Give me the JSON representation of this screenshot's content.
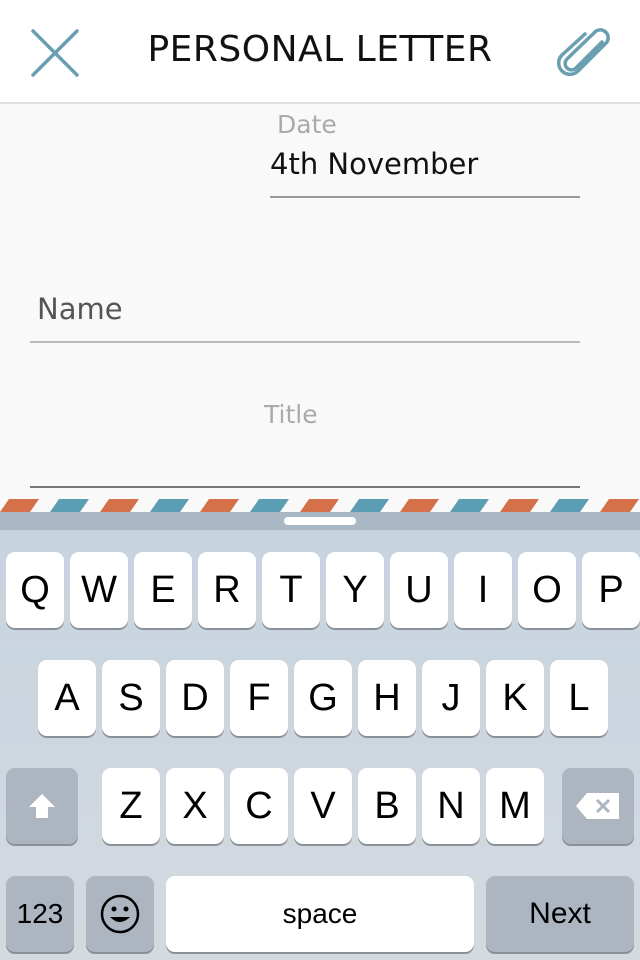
{
  "header": {
    "title": "PERSONAL LETTER",
    "close_icon": "close-icon",
    "attach_icon": "paperclip-icon",
    "accent": "#6a9fb2"
  },
  "form": {
    "date_label": "Date",
    "date_value": "4th November",
    "name_placeholder": "Name",
    "title_placeholder": "Title"
  },
  "keyboard": {
    "row1": [
      "Q",
      "W",
      "E",
      "R",
      "T",
      "Y",
      "U",
      "I",
      "O",
      "P"
    ],
    "row2": [
      "A",
      "S",
      "D",
      "F",
      "G",
      "H",
      "J",
      "K",
      "L"
    ],
    "row3": [
      "Z",
      "X",
      "C",
      "V",
      "B",
      "N",
      "M"
    ],
    "numbers": "123",
    "space": "space",
    "next": "Next"
  }
}
